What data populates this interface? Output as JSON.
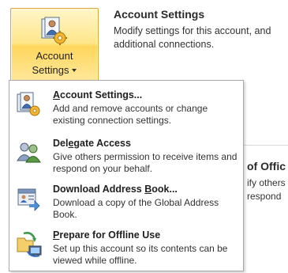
{
  "ribbon": {
    "button": {
      "line1": "Account",
      "line2": "Settings",
      "icon": "account-settings-icon"
    },
    "section": {
      "title": "Account Settings",
      "description": "Modify settings for this account, and additional connections."
    }
  },
  "background": {
    "heading": "of Offic",
    "line1": "ify others",
    "line2": "respond"
  },
  "menu": {
    "items": [
      {
        "title_pre": "",
        "title_mnemonic": "A",
        "title_post": "ccount Settings...",
        "description": "Add and remove accounts or change existing connection settings.",
        "icon": "account-settings-icon"
      },
      {
        "title_pre": "Del",
        "title_mnemonic": "e",
        "title_post": "gate Access",
        "description": "Give others permission to receive items and respond on your behalf.",
        "icon": "delegate-access-icon"
      },
      {
        "title_pre": "Download Address ",
        "title_mnemonic": "B",
        "title_post": "ook...",
        "description": "Download a copy of the Global Address Book.",
        "icon": "address-book-icon"
      },
      {
        "title_pre": "",
        "title_mnemonic": "P",
        "title_post": "repare for Offline Use",
        "description": "Set up this account so its contents can be viewed while offline.",
        "icon": "offline-sync-icon"
      }
    ]
  },
  "colors": {
    "button_highlight": "#ffd65c",
    "button_border": "#d9a83a",
    "menu_border": "#a8a8a8"
  }
}
